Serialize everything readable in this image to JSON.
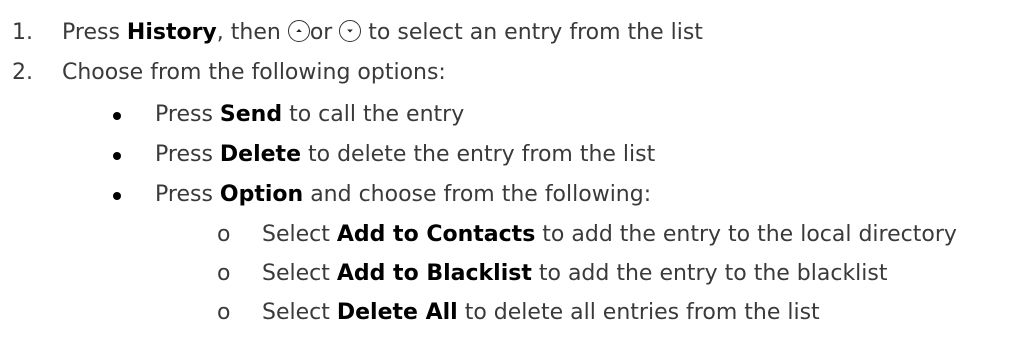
{
  "step1": {
    "number": "1.",
    "press": "Press ",
    "history": "History",
    "then": ", then ",
    "or": "or ",
    "rest": " to select an entry from the list",
    "up_icon": "up-arrow-circle-icon",
    "down_icon": "down-arrow-circle-icon"
  },
  "step2": {
    "number": "2.",
    "text": "Choose from the following options:"
  },
  "bullets": [
    {
      "press": "Press ",
      "key": "Send",
      "rest": " to call the entry"
    },
    {
      "press": "Press ",
      "key": "Delete",
      "rest": " to delete the entry from the list"
    },
    {
      "press": "Press ",
      "key": "Option",
      "rest": " and choose from the following:"
    }
  ],
  "sub_bullets": [
    {
      "marker": "o",
      "select": "Select ",
      "key": "Add to Contacts",
      "rest": " to add the entry to the local directory"
    },
    {
      "marker": "o",
      "select": "Select ",
      "key": "Add to Blacklist",
      "rest": " to add the entry to the blacklist"
    },
    {
      "marker": "o",
      "select": "Select ",
      "key": "Delete All",
      "rest": " to delete all entries from the list"
    }
  ]
}
